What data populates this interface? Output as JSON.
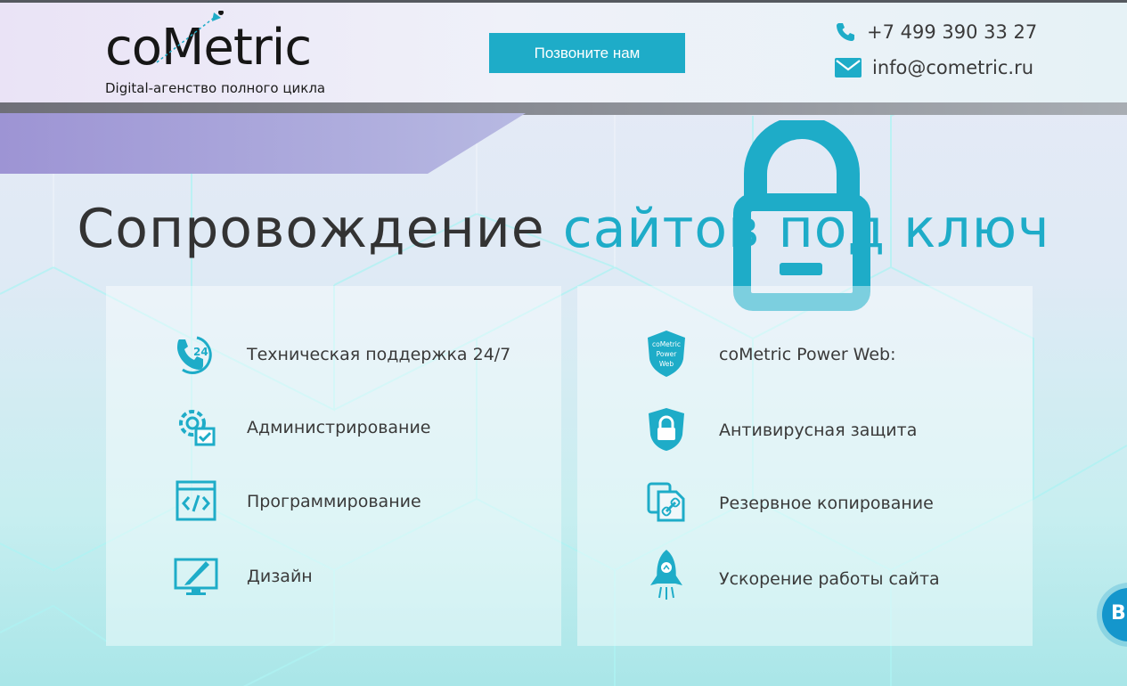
{
  "header": {
    "logo_text": "coMetric",
    "logo_tagline": "Digital-агенство полного цикла",
    "call_button": "Позвоните нам",
    "phone": "+7 499 390 33 27",
    "email": "info@cometric.ru"
  },
  "hero": {
    "title_main": "Сопровождение",
    "title_accent": "сайтов под ключ"
  },
  "left_card": {
    "items": [
      {
        "label": "Техническая поддержка 24/7",
        "icon": "support-24-icon"
      },
      {
        "label": "Администрирование",
        "icon": "admin-gear-icon"
      },
      {
        "label": "Программирование",
        "icon": "code-icon"
      },
      {
        "label": "Дизайн",
        "icon": "design-monitor-icon"
      }
    ]
  },
  "right_card": {
    "items": [
      {
        "label": "coMetric Power Web:",
        "icon": "power-web-shield-icon",
        "badge": [
          "coMetric",
          "Power",
          "Web"
        ]
      },
      {
        "label": "Антивирусная защита",
        "icon": "antivirus-lock-icon"
      },
      {
        "label": "Резервное копирование",
        "icon": "backup-icon"
      },
      {
        "label": "Ускорение работы сайта",
        "icon": "rocket-icon"
      }
    ]
  },
  "chat": {
    "label": "В"
  },
  "colors": {
    "accent": "#1eacc8",
    "text": "#3a3a3a"
  }
}
